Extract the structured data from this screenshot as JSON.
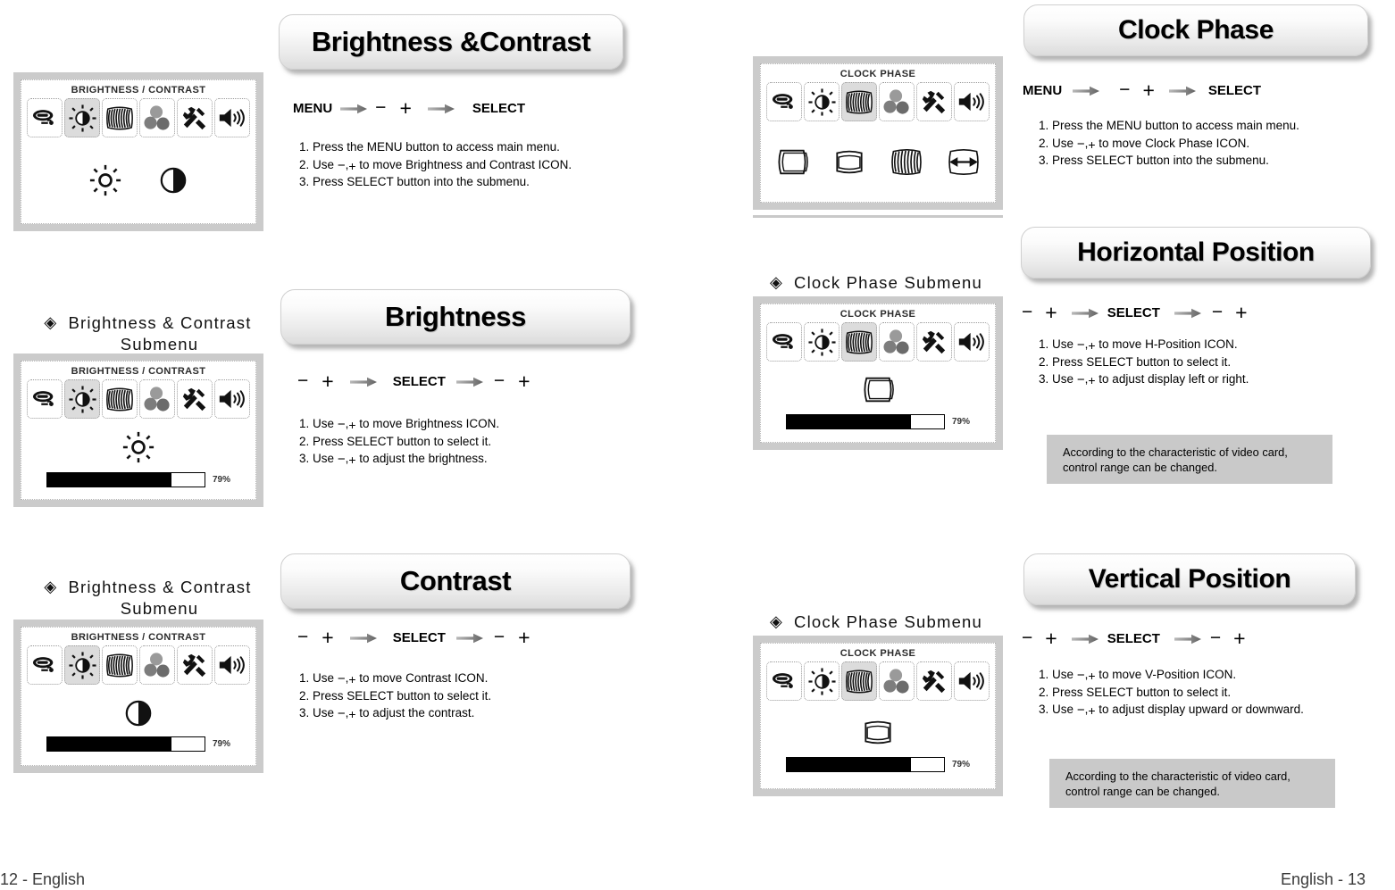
{
  "document": {
    "footer_left": "12 - English",
    "footer_right": "English - 13"
  },
  "note_text": {
    "line1": "According to the characteristic of video card,",
    "line2": "control range can be changed."
  },
  "symbols": {
    "minus": "−",
    "plus": "+",
    "comma": ",",
    "diamond": "◈",
    "arrow": "arrow-right-icon"
  },
  "left_page": {
    "sections": [
      {
        "id": "brightness-contrast",
        "title": "Brightness &Contrast",
        "sequence": [
          "MENU",
          "arrow",
          "−",
          "+",
          "arrow",
          "SELECT"
        ],
        "steps": [
          "1. Press the MENU button to access main menu.",
          "2. Use − ,+ to move Brightness and Contrast ICON.",
          "3. Press SELECT button into the submenu."
        ],
        "step_parts": [
          {
            "num": "1.",
            "pre": "Press the MENU button to access main menu.",
            "post": ""
          },
          {
            "num": "2.",
            "pre": "Use",
            "post": "to move Brightness and Contrast ICON."
          },
          {
            "num": "3.",
            "pre": "Press SELECT button into the submenu.",
            "post": ""
          }
        ],
        "osd": {
          "title": "BRIGHTNESS / CONTRAST",
          "selected_index": 1,
          "big_icons": [
            "sun-icon",
            "contrast-icon"
          ],
          "has_bar": false,
          "percent": ""
        },
        "caption": null
      },
      {
        "id": "brightness",
        "title": "Brightness",
        "sequence": [
          "−",
          "+",
          "arrow",
          "SELECT",
          "arrow",
          "−",
          "+"
        ],
        "step_parts": [
          {
            "num": "1.",
            "pre": "Use",
            "post": "to move Brightness ICON."
          },
          {
            "num": "2.",
            "pre": "Press SELECT button to select it.",
            "post": ""
          },
          {
            "num": "3.",
            "pre": "Use",
            "post": "to adjust the brightness."
          }
        ],
        "osd": {
          "title": "BRIGHTNESS / CONTRAST",
          "selected_index": 1,
          "big_icons": [
            "sun-icon"
          ],
          "has_bar": true,
          "percent": "79%",
          "percent_value": 79
        },
        "caption": {
          "line1": "Brightness  &  Contrast",
          "line2": "Submenu"
        }
      },
      {
        "id": "contrast",
        "title": "Contrast",
        "sequence": [
          "−",
          "+",
          "arrow",
          "SELECT",
          "arrow",
          "−",
          "+"
        ],
        "step_parts": [
          {
            "num": "1.",
            "pre": "Use",
            "post": "to move Contrast ICON."
          },
          {
            "num": "2.",
            "pre": "Press SELECT button to select it.",
            "post": ""
          },
          {
            "num": "3.",
            "pre": "Use",
            "post": "to adjust the contrast."
          }
        ],
        "osd": {
          "title": "BRIGHTNESS / CONTRAST",
          "selected_index": 1,
          "big_icons": [
            "contrast-icon"
          ],
          "has_bar": true,
          "percent": "79%",
          "percent_value": 79
        },
        "caption": {
          "line1": "Brightness  &  Contrast",
          "line2": "Submenu"
        }
      }
    ]
  },
  "right_page": {
    "sections": [
      {
        "id": "clock-phase",
        "title": "Clock Phase",
        "sequence": [
          "MENU",
          "arrow",
          "−",
          "+",
          "arrow",
          "SELECT"
        ],
        "step_parts": [
          {
            "num": "1.",
            "pre": "Press the MENU button to access main menu.",
            "post": ""
          },
          {
            "num": "2.",
            "pre": "Use",
            "post": "to move Clock Phase ICON."
          },
          {
            "num": "3.",
            "pre": "Press SELECT button into the submenu.",
            "post": ""
          }
        ],
        "osd": {
          "title": "CLOCK PHASE",
          "selected_index": 2,
          "big_icons": [
            "h-size-icon",
            "v-size-icon",
            "clock-phase-icon",
            "h-position-icon"
          ],
          "has_bar": false,
          "percent": ""
        },
        "caption": null,
        "note": false
      },
      {
        "id": "horizontal-position",
        "title": "Horizontal Position",
        "sequence": [
          "−",
          "+",
          "arrow",
          "SELECT",
          "arrow",
          "−",
          "+"
        ],
        "step_parts": [
          {
            "num": "1.",
            "pre": "Use",
            "post": "to move  H-Position ICON."
          },
          {
            "num": "2.",
            "pre": "Press SELECT button to select it.",
            "post": ""
          },
          {
            "num": "3.",
            "pre": "Use",
            "post": "to adjust display left or right."
          }
        ],
        "osd": {
          "title": "CLOCK PHASE",
          "selected_index": 2,
          "big_icons": [
            "h-size-icon"
          ],
          "has_bar": true,
          "percent": "79%",
          "percent_value": 79
        },
        "caption": {
          "line1": "Clock Phase Submenu",
          "line2": ""
        },
        "note": true
      },
      {
        "id": "vertical-position",
        "title": "Vertical Position",
        "sequence": [
          "−",
          "+",
          "arrow",
          "SELECT",
          "arrow",
          "−",
          "+"
        ],
        "step_parts": [
          {
            "num": "1.",
            "pre": "Use",
            "post": "to move V-Position ICON."
          },
          {
            "num": "2.",
            "pre": " Press SELECT button to select it.",
            "post": ""
          },
          {
            "num": "3.",
            "pre": "Use",
            "post": "to adjust display upward or downward."
          }
        ],
        "osd": {
          "title": "CLOCK PHASE",
          "selected_index": 2,
          "big_icons": [
            "v-size-icon"
          ],
          "has_bar": true,
          "percent": "79%",
          "percent_value": 79
        },
        "caption": {
          "line1": "Clock Phase Submenu",
          "line2": ""
        },
        "note": true
      }
    ]
  },
  "osd_menu_icons": [
    "input-source-icon",
    "brightness-icon",
    "clock-phase-icon",
    "color-icon",
    "tools-icon",
    "volume-icon"
  ]
}
